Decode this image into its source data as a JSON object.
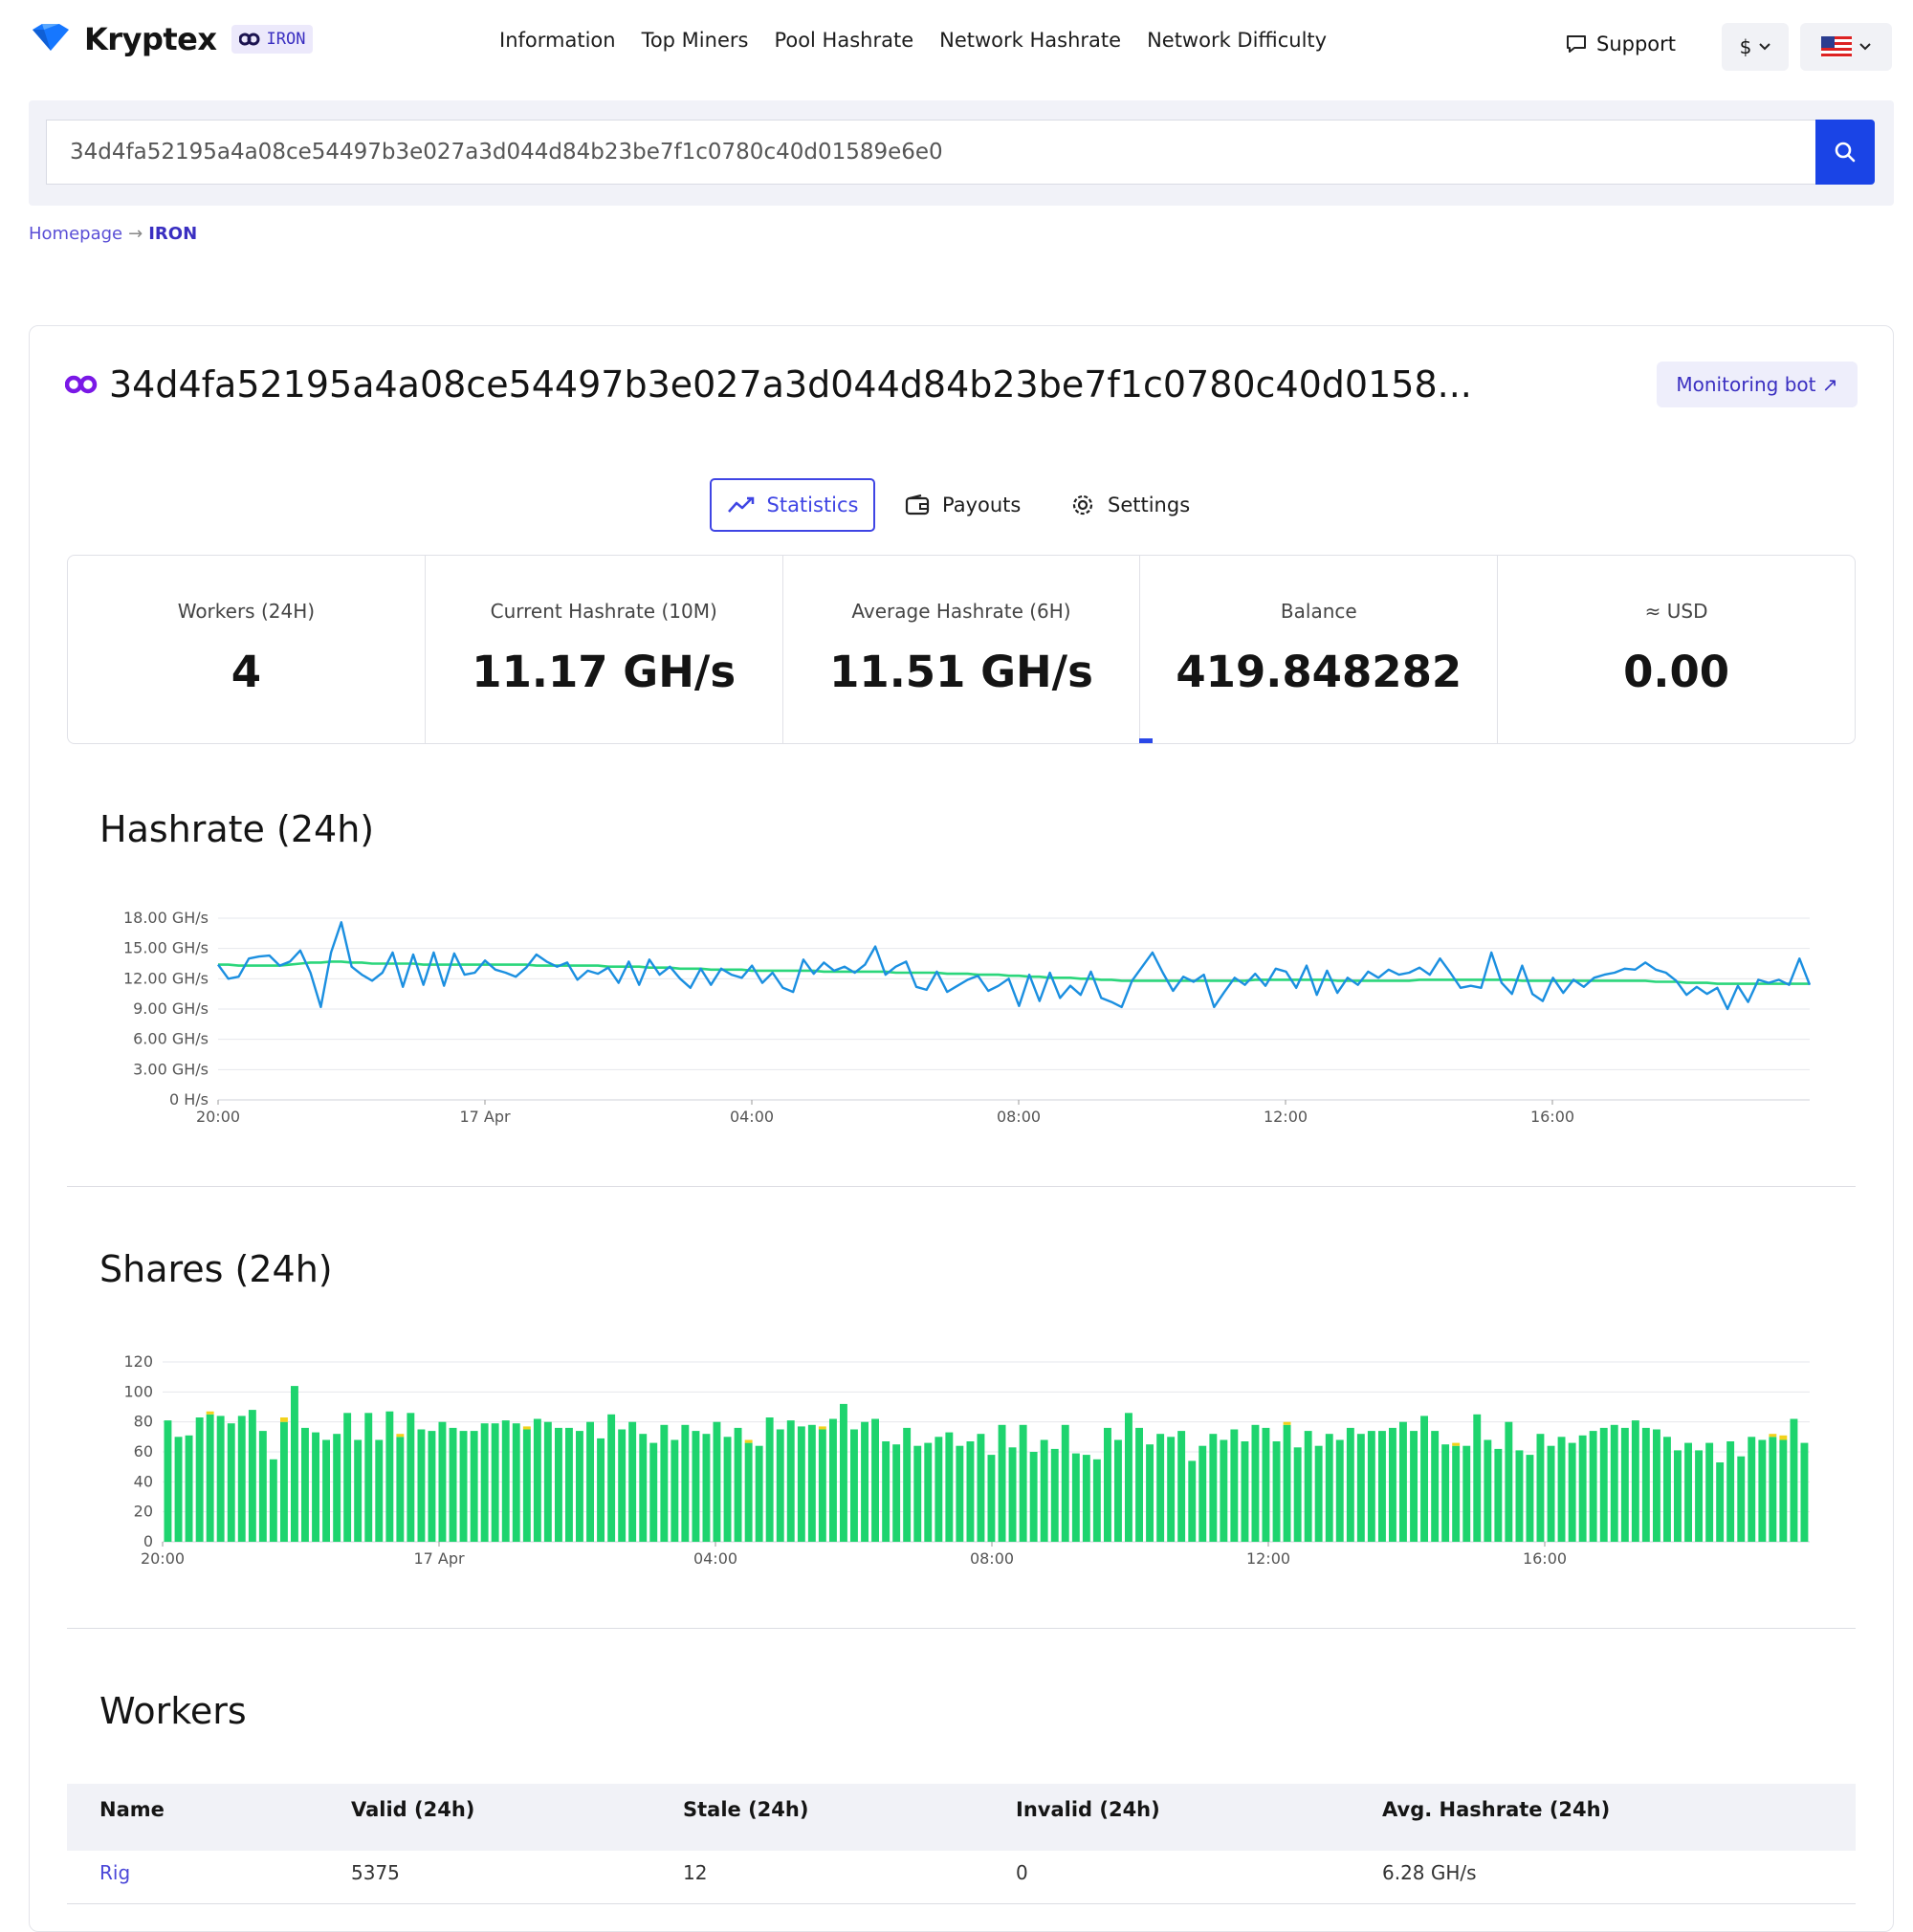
{
  "brand": {
    "name": "Kryptex",
    "coin_badge": "IRON"
  },
  "nav": [
    "Information",
    "Top Miners",
    "Pool Hashrate",
    "Network Hashrate",
    "Network Difficulty"
  ],
  "header": {
    "support_label": "Support",
    "currency_label": "$"
  },
  "search": {
    "value": "34d4fa52195a4a08ce54497b3e027a3d044d84b23be7f1c0780c40d01589e6e0"
  },
  "breadcrumb": {
    "home": "Homepage",
    "separator": "→",
    "current": "IRON"
  },
  "wallet": {
    "address_display": "34d4fa52195a4a08ce54497b3e027a3d044d84b23be7f1c0780c40d0158...",
    "monitoring_label": "Monitoring bot ↗"
  },
  "tabs": [
    "Statistics",
    "Payouts",
    "Settings"
  ],
  "stats": [
    {
      "label": "Workers (24H)",
      "value": "4"
    },
    {
      "label": "Current Hashrate (10M)",
      "value": "11.17 GH/s"
    },
    {
      "label": "Average Hashrate (6H)",
      "value": "11.51 GH/s"
    },
    {
      "label": "Balance",
      "value": "419.848282"
    },
    {
      "label": "≈ USD",
      "value": "0.00"
    }
  ],
  "sections": {
    "hashrate": "Hashrate (24h)",
    "shares": "Shares (24h)",
    "workers": "Workers"
  },
  "colors": {
    "accent": "#3f45e4",
    "brand": "#6b2bd9",
    "hashrate_line": "#1b8fe0",
    "average_line": "#2bd67b",
    "valid_bar": "#1ed46e",
    "stale_bar": "#f2d21c"
  },
  "chart_data": [
    {
      "type": "line",
      "title": "Hashrate (24h)",
      "x_ticks": [
        "20:00",
        "17 Apr",
        "04:00",
        "08:00",
        "12:00",
        "16:00"
      ],
      "y_ticks": [
        "18.00 GH/s",
        "15.00 GH/s",
        "12.00 GH/s",
        "9.00 GH/s",
        "6.00 GH/s",
        "3.00 GH/s",
        "0 H/s"
      ],
      "ylim": [
        0,
        18
      ],
      "series": [
        {
          "values": [
            13.4,
            12.0,
            12.2,
            14.0,
            14.2,
            14.3,
            13.3,
            13.7,
            14.8,
            12.6,
            9.2,
            14.6,
            17.6,
            13.2,
            12.4,
            11.8,
            12.6,
            14.6,
            11.2,
            14.4,
            11.4,
            14.6,
            11.3,
            14.5,
            12.4,
            12.6,
            13.8,
            12.9,
            12.6,
            12.2,
            13.1,
            14.4,
            13.7,
            13.2,
            13.6,
            11.9,
            12.8,
            12.5,
            13.1,
            11.6,
            13.7,
            11.4,
            13.9,
            12.4,
            13.2,
            12.0,
            11.1,
            13.0,
            11.4,
            13.0,
            12.4,
            12.1,
            13.3,
            11.6,
            12.6,
            11.1,
            10.7,
            13.9,
            12.5,
            13.6,
            12.8,
            13.2,
            12.6,
            13.4,
            15.2,
            12.4,
            13.2,
            13.7,
            11.2,
            10.9,
            12.7,
            10.7,
            11.3,
            11.9,
            12.3,
            10.8,
            11.3,
            12.0,
            9.3,
            12.4,
            9.8,
            12.6,
            10.1,
            11.3,
            10.4,
            12.7,
            10.1,
            9.7,
            9.2,
            11.8,
            13.2,
            14.6,
            12.6,
            10.8,
            12.2,
            11.7,
            12.4,
            9.2,
            10.7,
            12.1,
            11.4,
            12.5,
            11.3,
            13.0,
            12.7,
            11.1,
            13.3,
            10.4,
            12.8,
            10.6,
            12.1,
            11.4,
            12.7,
            12.1,
            12.9,
            12.4,
            12.6,
            13.1,
            12.4,
            14.0,
            12.6,
            11.1,
            11.3,
            11.1,
            14.6,
            11.6,
            10.5,
            13.3,
            10.5,
            9.8,
            12.1,
            10.6,
            11.9,
            11.2,
            12.1,
            12.4,
            12.6,
            13.0,
            12.9,
            13.6,
            12.9,
            12.6,
            11.8,
            10.4,
            11.2,
            10.5,
            11.1,
            9.0,
            11.3,
            9.7,
            11.9,
            11.6,
            11.9,
            11.4,
            14.0,
            11.4
          ]
        },
        {
          "values": [
            13.4,
            13.4,
            13.3,
            13.3,
            13.3,
            13.3,
            13.3,
            13.4,
            13.5,
            13.6,
            13.6,
            13.7,
            13.7,
            13.6,
            13.6,
            13.5,
            13.5,
            13.5,
            13.5,
            13.5,
            13.4,
            13.4,
            13.4,
            13.4,
            13.4,
            13.4,
            13.4,
            13.4,
            13.4,
            13.4,
            13.4,
            13.3,
            13.3,
            13.3,
            13.3,
            13.3,
            13.3,
            13.3,
            13.2,
            13.2,
            13.2,
            13.2,
            13.1,
            13.1,
            13.1,
            13.0,
            13.0,
            13.0,
            12.9,
            12.9,
            12.9,
            12.9,
            12.8,
            12.8,
            12.8,
            12.8,
            12.8,
            12.8,
            12.8,
            12.7,
            12.7,
            12.7,
            12.7,
            12.7,
            12.7,
            12.7,
            12.6,
            12.6,
            12.6,
            12.6,
            12.6,
            12.5,
            12.5,
            12.5,
            12.4,
            12.4,
            12.4,
            12.3,
            12.3,
            12.2,
            12.2,
            12.1,
            12.1,
            12.1,
            12.0,
            12.0,
            11.9,
            11.9,
            11.8,
            11.8,
            11.8,
            11.8,
            11.8,
            11.8,
            11.8,
            11.8,
            11.8,
            11.8,
            11.8,
            11.8,
            11.8,
            11.9,
            11.9,
            11.9,
            11.9,
            11.9,
            11.9,
            11.9,
            11.9,
            11.8,
            11.8,
            11.8,
            11.8,
            11.8,
            11.8,
            11.8,
            11.8,
            11.9,
            11.9,
            11.9,
            11.9,
            11.9,
            11.9,
            11.9,
            11.9,
            11.9,
            11.9,
            11.8,
            11.8,
            11.8,
            11.8,
            11.8,
            11.8,
            11.8,
            11.8,
            11.8,
            11.8,
            11.8,
            11.8,
            11.8,
            11.7,
            11.7,
            11.7,
            11.6,
            11.6,
            11.6,
            11.5,
            11.5,
            11.5,
            11.5,
            11.5,
            11.5,
            11.5,
            11.5,
            11.5,
            11.5
          ]
        }
      ]
    },
    {
      "type": "bar",
      "title": "Shares (24h)",
      "x_ticks": [
        "20:00",
        "17 Apr",
        "04:00",
        "08:00",
        "12:00",
        "16:00"
      ],
      "y_ticks": [
        "120",
        "100",
        "80",
        "60",
        "40",
        "20",
        "0"
      ],
      "ylim": [
        0,
        120
      ],
      "series": [
        {
          "values": [
            81,
            70,
            71,
            83,
            85,
            84,
            79,
            84,
            88,
            74,
            55,
            80,
            104,
            76,
            73,
            68,
            72,
            86,
            68,
            86,
            68,
            87,
            70,
            86,
            75,
            74,
            80,
            76,
            74,
            74,
            79,
            79,
            81,
            79,
            75,
            82,
            80,
            76,
            76,
            74,
            80,
            69,
            85,
            75,
            80,
            72,
            66,
            78,
            68,
            78,
            74,
            72,
            80,
            70,
            76,
            66,
            64,
            83,
            75,
            81,
            77,
            78,
            75,
            82,
            92,
            75,
            80,
            82,
            67,
            65,
            76,
            64,
            66,
            70,
            73,
            64,
            67,
            72,
            58,
            78,
            63,
            78,
            60,
            68,
            62,
            78,
            59,
            58,
            55,
            76,
            68,
            86,
            76,
            65,
            72,
            70,
            74,
            54,
            64,
            72,
            68,
            75,
            67,
            78,
            76,
            67,
            78,
            63,
            74,
            64,
            72,
            68,
            76,
            72,
            74,
            74,
            76,
            80,
            74,
            84,
            74,
            65,
            64,
            64,
            85,
            68,
            62,
            80,
            61,
            58,
            72,
            64,
            70,
            66,
            71,
            74,
            76,
            78,
            76,
            81,
            76,
            75,
            70,
            61,
            66,
            61,
            66,
            53,
            67,
            57,
            70,
            68,
            70,
            68,
            82,
            66
          ]
        },
        {
          "values": [
            0,
            0,
            0,
            0,
            2,
            0,
            0,
            0,
            0,
            0,
            0,
            3,
            0,
            0,
            0,
            0,
            0,
            0,
            0,
            0,
            0,
            0,
            2,
            0,
            0,
            0,
            0,
            0,
            0,
            0,
            0,
            0,
            0,
            0,
            2,
            0,
            0,
            0,
            0,
            0,
            0,
            0,
            0,
            0,
            0,
            0,
            0,
            0,
            0,
            0,
            0,
            0,
            0,
            0,
            0,
            2,
            0,
            0,
            0,
            0,
            0,
            0,
            2,
            0,
            0,
            0,
            0,
            0,
            0,
            0,
            0,
            0,
            0,
            0,
            0,
            0,
            0,
            0,
            0,
            0,
            0,
            0,
            0,
            0,
            0,
            0,
            0,
            0,
            0,
            0,
            0,
            0,
            0,
            0,
            0,
            0,
            0,
            0,
            0,
            0,
            0,
            0,
            0,
            0,
            0,
            0,
            2,
            0,
            0,
            0,
            0,
            0,
            0,
            0,
            0,
            0,
            0,
            0,
            0,
            0,
            0,
            0,
            2,
            0,
            0,
            0,
            0,
            0,
            0,
            0,
            0,
            0,
            0,
            0,
            0,
            0,
            0,
            0,
            0,
            0,
            0,
            0,
            0,
            0,
            0,
            0,
            0,
            0,
            0,
            0,
            0,
            0,
            2,
            3,
            0,
            0
          ]
        }
      ]
    }
  ],
  "workers_table": {
    "columns": [
      "Name",
      "Valid (24h)",
      "Stale (24h)",
      "Invalid (24h)",
      "Avg. Hashrate (24h)"
    ],
    "rows": [
      [
        "Rig",
        "5375",
        "12",
        "0",
        "6.28 GH/s"
      ]
    ]
  }
}
